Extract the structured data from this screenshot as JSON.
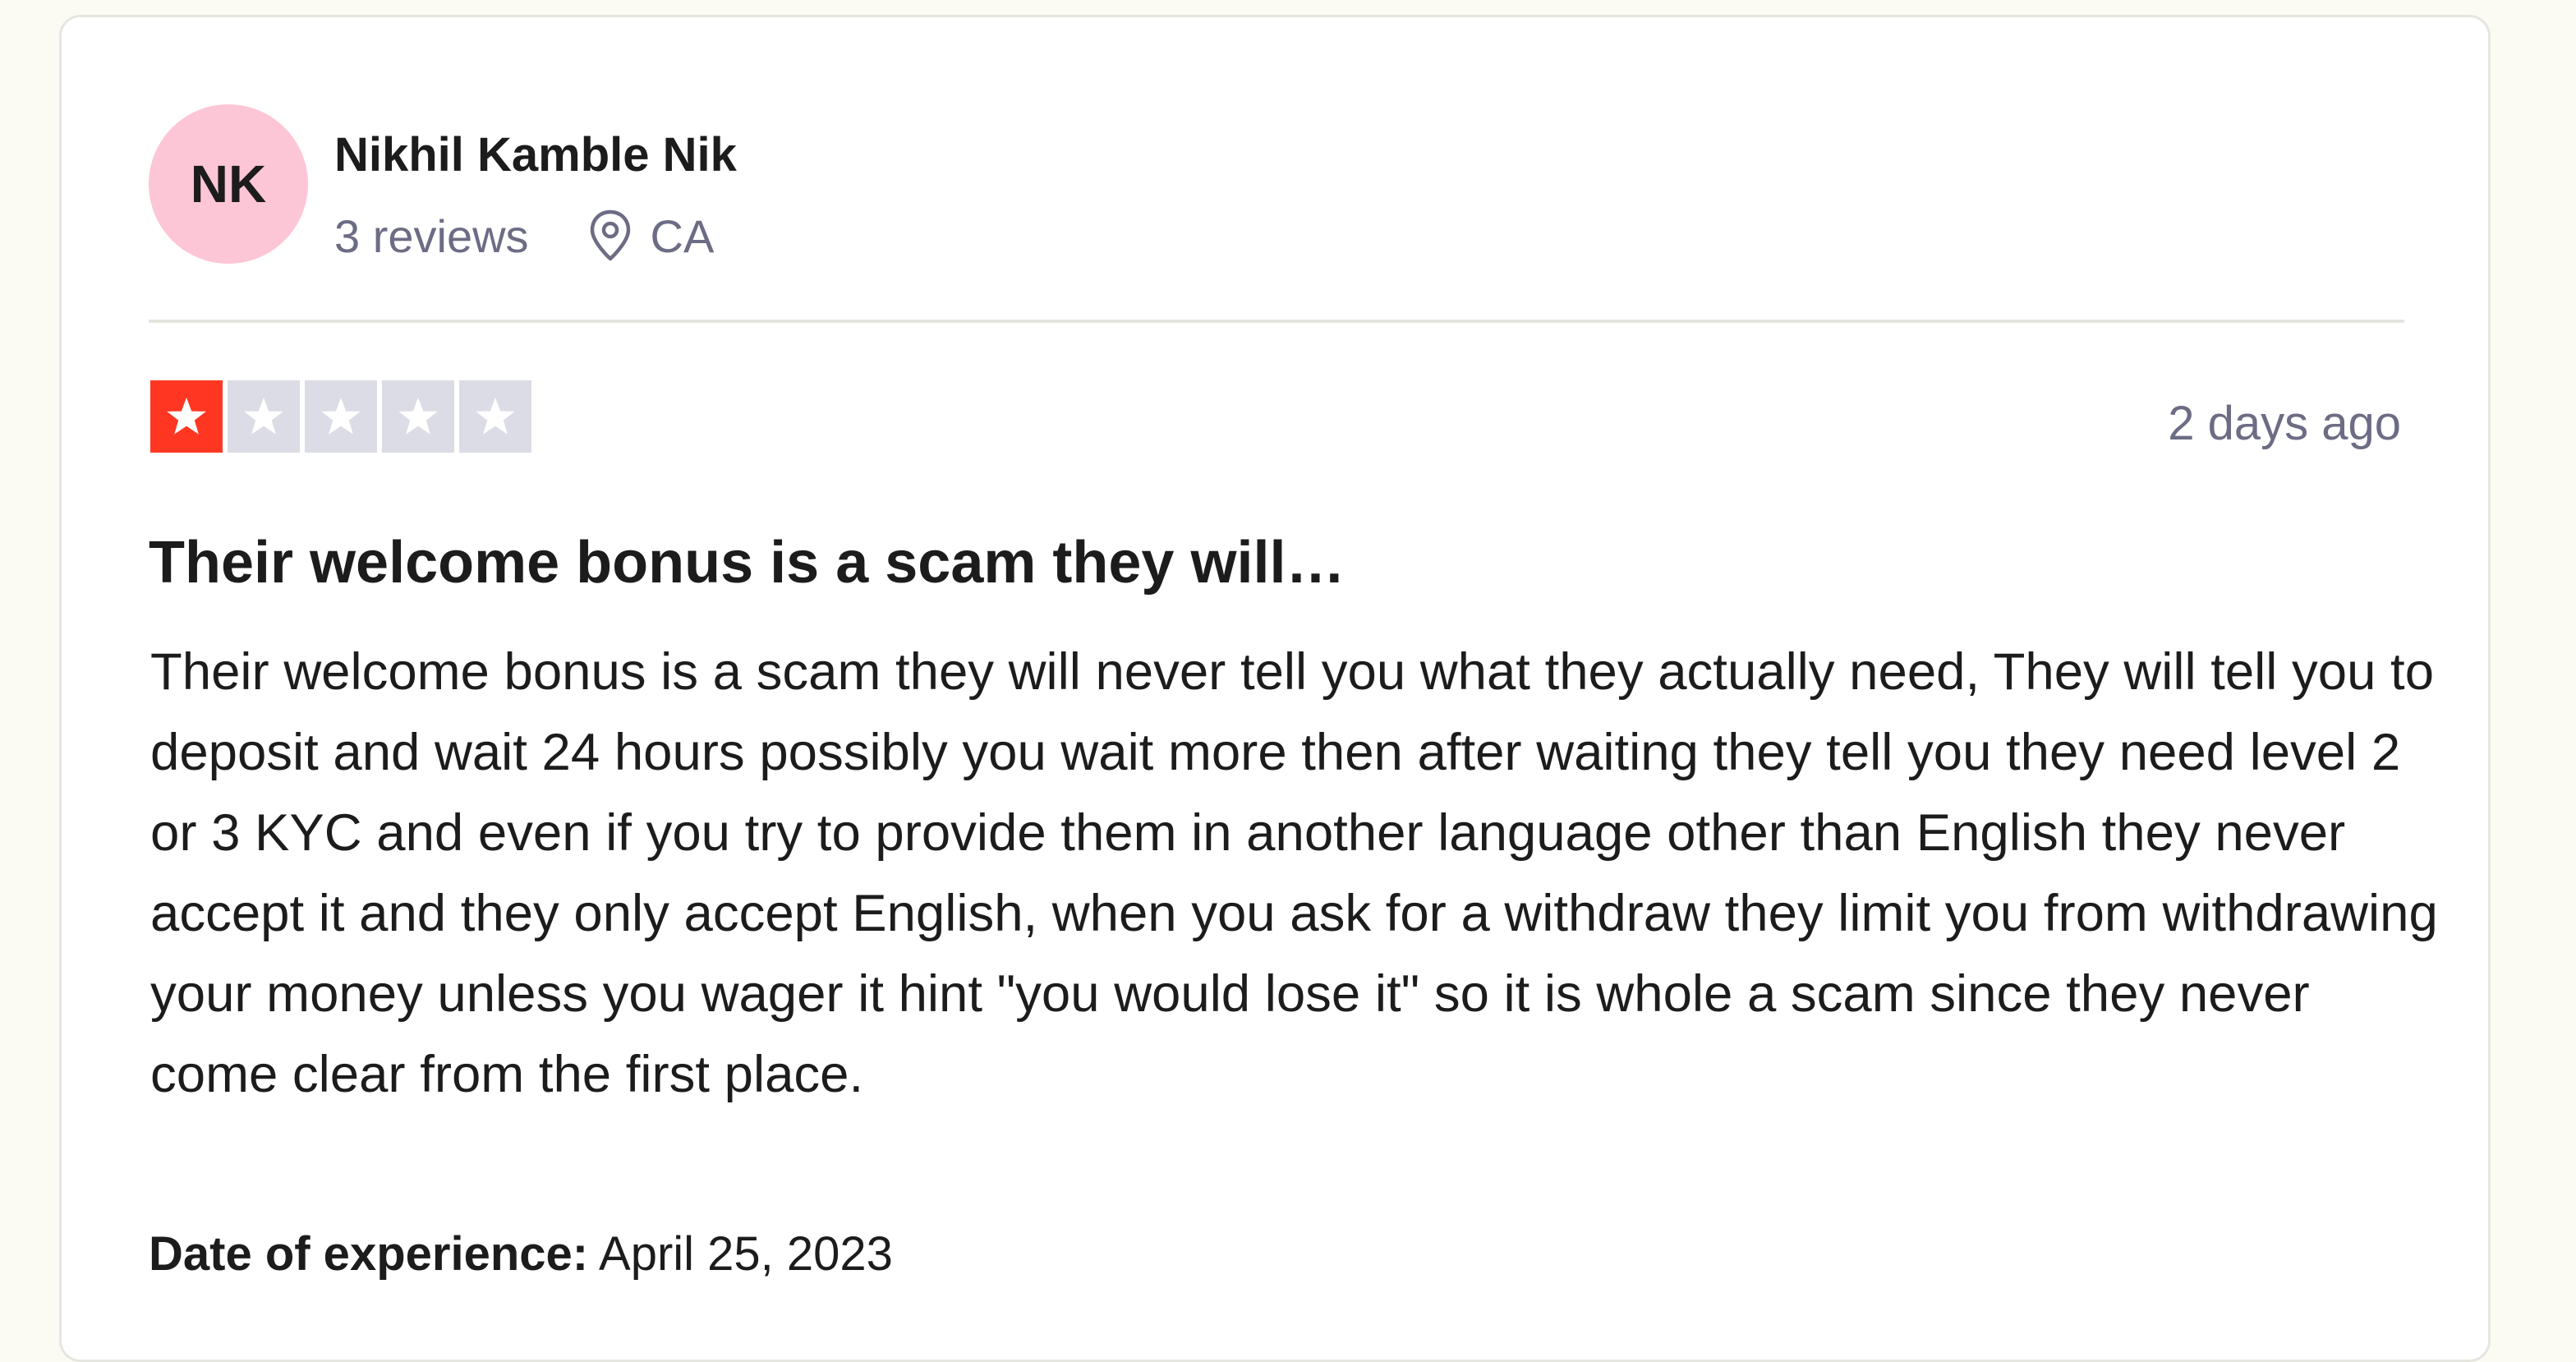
{
  "reviewer": {
    "initials": "NK",
    "name": "Nikhil Kamble Nik",
    "review_count": "3 reviews",
    "location": "CA",
    "avatar_color": "#fdc6d6"
  },
  "review": {
    "rating": 1,
    "rating_max": 5,
    "posted": "2 days ago",
    "title": "Their welcome bonus is a scam they will…",
    "body": "Their welcome bonus is a scam they will never tell you what they actually need, They will tell you to deposit and wait 24 hours possibly you wait more then after waiting they tell you they need level 2 or 3 KYC and even if you try to provide them in another language other than English they never accept it and they only accept English, when you ask for a withdraw they limit you from withdrawing your money unless you wager it hint \"you would lose it\" so it is whole a scam since they never come clear from the first place.",
    "experience_label": "Date of experience:",
    "experience_date": "April 25, 2023"
  },
  "colors": {
    "star_filled": "#ff3722",
    "star_empty": "#dcdce6",
    "muted_text": "#6c6c85",
    "card_bg": "#ffffff",
    "page_bg": "#fbfbf4"
  },
  "icons": {
    "location": "map-pin-icon",
    "star": "star-icon"
  }
}
